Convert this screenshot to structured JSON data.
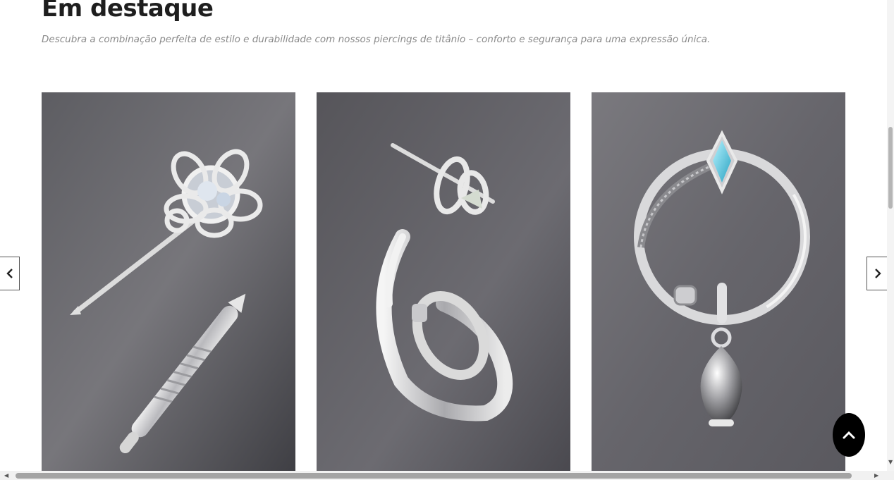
{
  "section": {
    "title": "Em destaque",
    "subtitle": "Descubra a combinação perfeita de estilo e durabilidade com nossos piercings de titânio – conforto e segurança para uma expressão única."
  },
  "carousel": {
    "products": [
      {
        "image_alt": "Piercing de titânio com flor de cristal e barra espiral"
      },
      {
        "image_alt": "Piercing de titânio com espiral e argola em gancho"
      },
      {
        "image_alt": "Piercing de titânio argola com pedra azul e pingente"
      }
    ],
    "prev_icon": "chevron-left-icon",
    "next_icon": "chevron-right-icon"
  },
  "back_to_top_icon": "chevron-up-icon",
  "colors": {
    "title": "#1e1e1e",
    "subtitle": "#8a8a8a",
    "card_background": "#6e6d73",
    "back_to_top": "#000000"
  }
}
